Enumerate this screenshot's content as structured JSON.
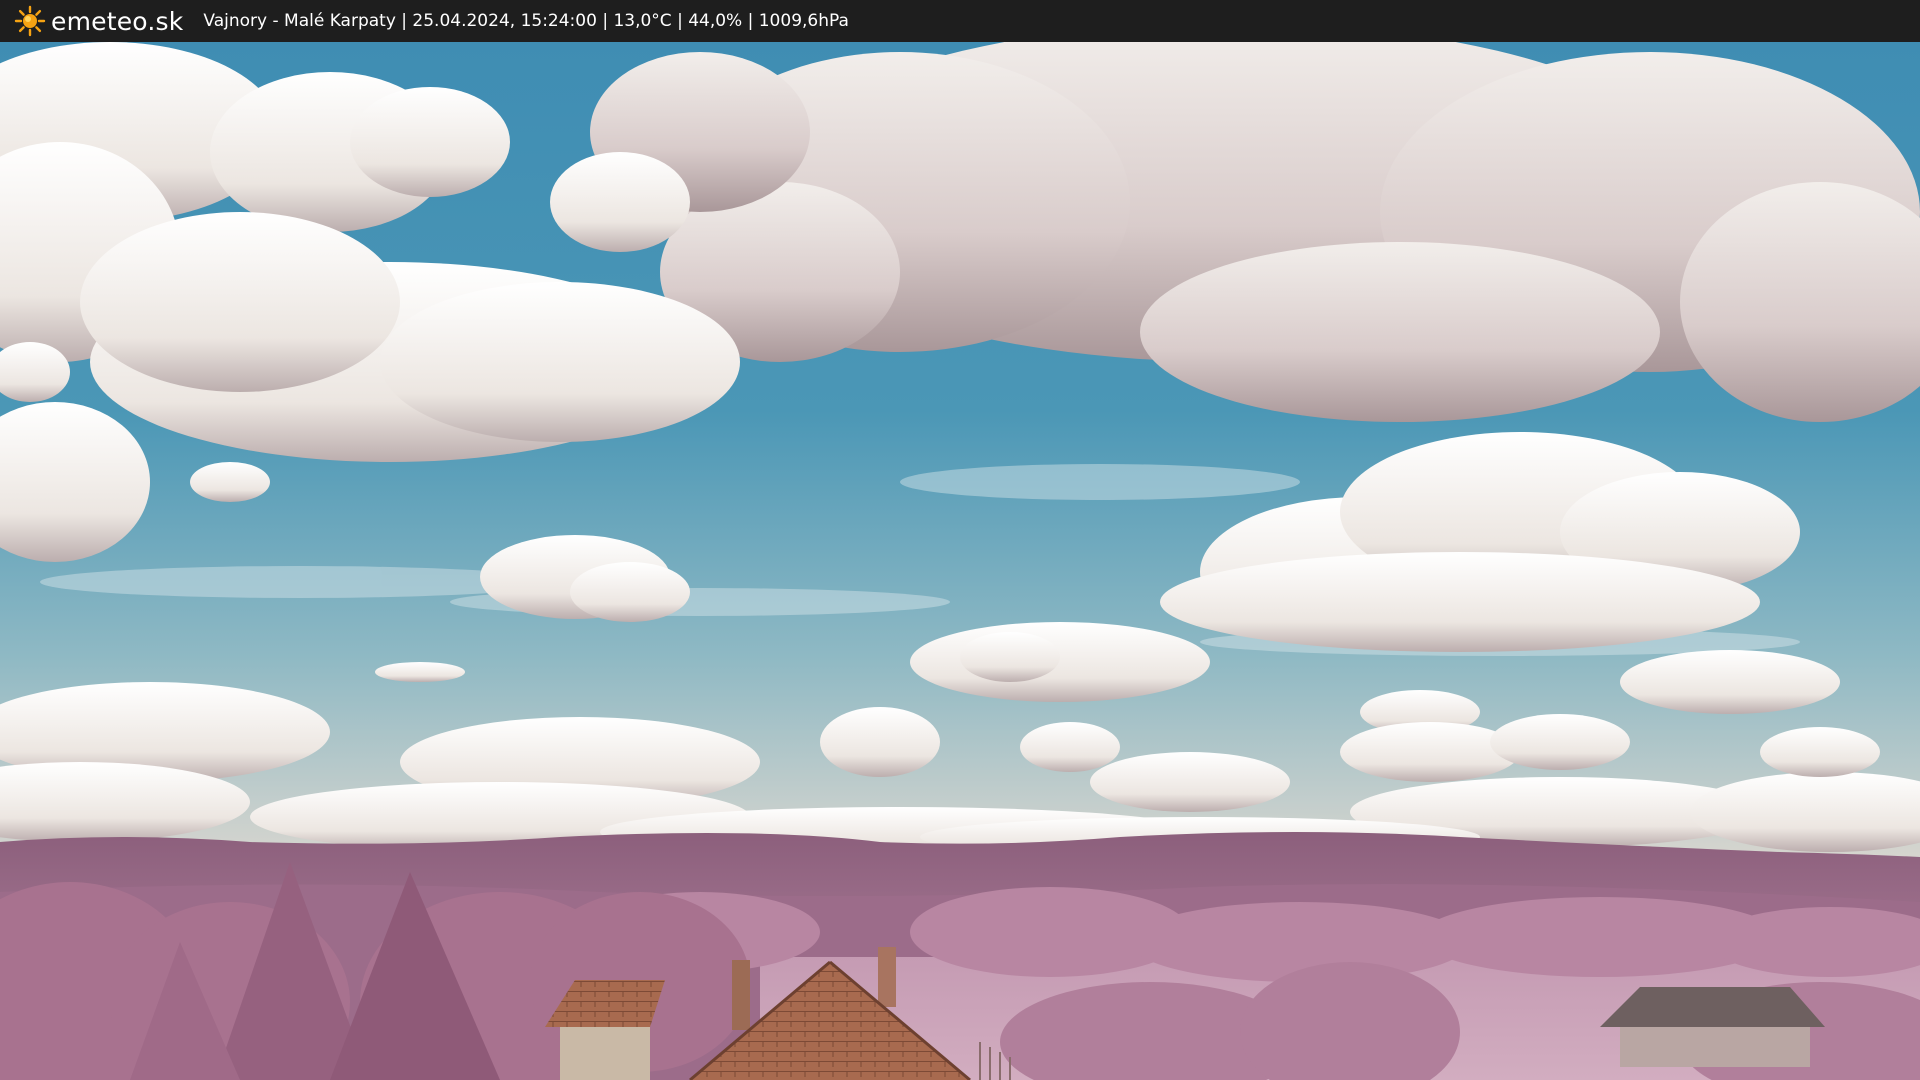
{
  "header": {
    "brand": "emeteo.sk",
    "caption": "Vajnory - Malé Karpaty | 25.04.2024, 15:24:00 | 13,0°C | 44,0% | 1009,6hPa",
    "logo_icon": "sun-icon"
  },
  "colors": {
    "bar_background": "#1e1e1e",
    "sun_fill": "#f6a313",
    "sky": "#4a93b4",
    "cloud": "#f0ebe6",
    "foliage": "#b47a9a",
    "hills": "#8a5a78",
    "roof": "#b86a48"
  }
}
